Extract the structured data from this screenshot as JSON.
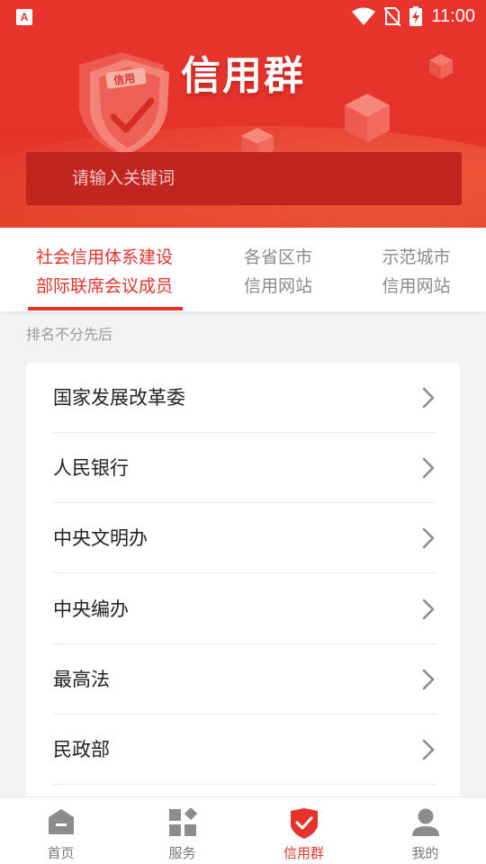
{
  "status": {
    "time": "11:00"
  },
  "header": {
    "title": "信用群",
    "shield_text": "信用"
  },
  "search": {
    "placeholder": "请输入关键词"
  },
  "tabs": [
    {
      "line1": "社会信用体系建设",
      "line2": "部际联席会议成员"
    },
    {
      "line1": "各省区市",
      "line2": "信用网站"
    },
    {
      "line1": "示范城市",
      "line2": "信用网站"
    }
  ],
  "note": "排名不分先后",
  "list": [
    "国家发展改革委",
    "人民银行",
    "中央文明办",
    "中央编办",
    "最高法",
    "民政部"
  ],
  "nav": [
    {
      "label": "首页",
      "icon": "home-icon"
    },
    {
      "label": "服务",
      "icon": "grid-icon"
    },
    {
      "label": "信用群",
      "icon": "shield-check-icon"
    },
    {
      "label": "我的",
      "icon": "user-icon"
    }
  ],
  "colors": {
    "accent": "#e5332c",
    "search_bg": "#c12520"
  }
}
